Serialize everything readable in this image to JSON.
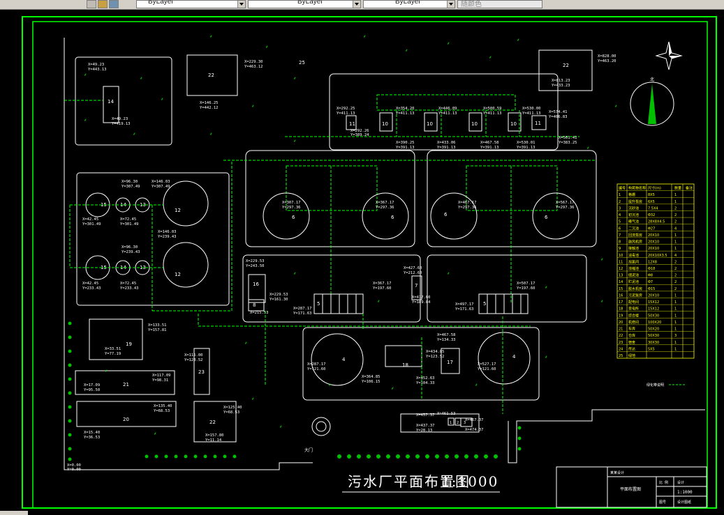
{
  "toolbar": {
    "layer_combo_1": "ByLayer",
    "layer_combo_2": "ByLayer",
    "layer_combo_3": "ByLayer",
    "color_combo": "随颜色"
  },
  "drawing": {
    "title": "污水厂平面布置图",
    "scale": "1:1000",
    "site_number": "25",
    "north_label": "北",
    "gate_label": "大门",
    "legend_label": "绿化带说明"
  },
  "units": [
    {
      "id": "u14",
      "num": "14",
      "coords": [
        "X=49.23",
        "Y=443.13"
      ]
    },
    {
      "id": "u14b",
      "num": "",
      "coords": [
        "X=49.23",
        "Y=419.13"
      ]
    },
    {
      "id": "u22a",
      "num": "22",
      "coords": [
        "X=229.30",
        "Y=463.12",
        "X=146.25",
        "Y=442.12"
      ]
    },
    {
      "id": "u22b",
      "num": "22",
      "coords": [
        "X=828.00",
        "Y=463.20",
        "X=813.23",
        "Y=433.23"
      ]
    },
    {
      "id": "u11a",
      "num": "11",
      "coords": [
        "X=292.25",
        "Y=411.13",
        "X=292.26",
        "Y=389.24"
      ]
    },
    {
      "id": "u10",
      "num": "10",
      "coords": [
        "X=354.20",
        "Y=411.13",
        "X=390.25",
        "Y=391.13"
      ]
    },
    {
      "id": "u10b",
      "num": "10",
      "coords": [
        "X=446.09",
        "Y=411.13",
        "X=433.06",
        "Y=391.13"
      ]
    },
    {
      "id": "u10c",
      "num": "10",
      "coords": [
        "X=500.59",
        "Y=411.13",
        "X=467.58",
        "Y=391.13"
      ]
    },
    {
      "id": "u10d",
      "num": "10",
      "coords": [
        "X=530.00",
        "Y=411.13",
        "X=530.01",
        "Y=391.13"
      ]
    },
    {
      "id": "u11b",
      "num": "11",
      "coords": [
        "X=574.41",
        "Y=406.83",
        "X=561.41",
        "Y=383.25"
      ]
    },
    {
      "id": "u15a",
      "num": "15",
      "coords": [
        "X=96.30",
        "Y=307.49",
        "X=42.45",
        "Y=301.49"
      ]
    },
    {
      "id": "u14c",
      "num": "14",
      "coords": [
        "X=72.45",
        "Y=301.49"
      ]
    },
    {
      "id": "u13a",
      "num": "13",
      "coords": []
    },
    {
      "id": "u12a",
      "num": "12",
      "coords": [
        "X=146.03",
        "Y=307.49"
      ]
    },
    {
      "id": "u12b",
      "num": "12",
      "coords": [
        "X=146.03",
        "Y=239.43"
      ]
    },
    {
      "id": "u15b",
      "num": "15",
      "coords": [
        "X=96.30",
        "Y=239.43",
        "X=42.45",
        "Y=233.43"
      ]
    },
    {
      "id": "u14d",
      "num": "14",
      "coords": [
        "X=72.45",
        "Y=233.43"
      ]
    },
    {
      "id": "u13b",
      "num": "13",
      "coords": []
    },
    {
      "id": "u6a",
      "num": "6",
      "coords": [
        "X=307.17",
        "Y=297.36"
      ]
    },
    {
      "id": "u6b",
      "num": "6",
      "coords": [
        "X=367.17",
        "Y=297.36"
      ]
    },
    {
      "id": "u6c",
      "num": "6",
      "coords": [
        "X=467.17",
        "Y=297.36"
      ]
    },
    {
      "id": "u6d",
      "num": "6",
      "coords": [
        "X=567.17",
        "Y=297.36"
      ]
    },
    {
      "id": "u16",
      "num": "16",
      "coords": [
        "X=229.53",
        "Y=243.50",
        "X=229.53",
        "Y=161.30"
      ]
    },
    {
      "id": "u8",
      "num": "8",
      "coords": [
        "X=215.53",
        "Y=179.50"
      ]
    },
    {
      "id": "u5a",
      "num": "5",
      "coords": [
        "X=367.17",
        "Y=197.60",
        "X=287.17",
        "Y=171.63"
      ]
    },
    {
      "id": "u7",
      "num": "7",
      "coords": [
        "X=427.60",
        "Y=212.60",
        "X=417.60",
        "Y=189.84"
      ]
    },
    {
      "id": "u5b",
      "num": "5",
      "coords": [
        "X=507.17",
        "Y=197.60",
        "X=497.17",
        "Y=171.63"
      ]
    },
    {
      "id": "u19",
      "num": "19",
      "coords": [
        "X=133.51",
        "Y=157.81",
        "X=33.51",
        "Y=77.19"
      ]
    },
    {
      "id": "u23",
      "num": "23",
      "coords": [
        "X=115.00",
        "Y=123.52"
      ]
    },
    {
      "id": "u21",
      "num": "21",
      "coords": [
        "X=117.09",
        "Y=98.31",
        "X=17.09",
        "Y=95.50"
      ]
    },
    {
      "id": "u20",
      "num": "20",
      "coords": [
        "X=135.40",
        "Y=68.53",
        "X=15.40",
        "Y=36.53"
      ]
    },
    {
      "id": "u22c",
      "num": "22",
      "coords": [
        "X=125.40",
        "Y=68.53",
        "X=157.80",
        "Y=11.14"
      ]
    },
    {
      "id": "u4a",
      "num": "4",
      "coords": [
        "X=287.17",
        "Y=121.60"
      ]
    },
    {
      "id": "u18",
      "num": "18",
      "coords": [
        "X=434.85",
        "Y=123.52",
        "X=364.85",
        "Y=106.15"
      ]
    },
    {
      "id": "u17",
      "num": "17",
      "coords": [
        "X=467.58",
        "Y=134.33",
        "X=452.63",
        "Y=104.33"
      ]
    },
    {
      "id": "u4b",
      "num": "4",
      "coords": [
        "X=527.17",
        "Y=121.60"
      ]
    },
    {
      "id": "u1",
      "num": "1",
      "coords": [
        "X=457.37",
        "Y=40.05",
        "X=437.37",
        "Y=28.13"
      ]
    },
    {
      "id": "u2",
      "num": "2",
      "coords": [
        "X=461.53",
        "Y=40.05"
      ]
    },
    {
      "id": "u3",
      "num": "3",
      "coords": [
        "X=467.37",
        "Y=40.05",
        "X=474.37",
        "Y=40.87"
      ]
    },
    {
      "id": "uorigin",
      "num": "",
      "coords": [
        "X=0.00",
        "Y=0.00"
      ]
    }
  ],
  "table": {
    "headers": [
      "编号",
      "构筑物名称",
      "尺寸(m)",
      "数量",
      "备注"
    ],
    "rows": [
      [
        "1",
        "格栅",
        "8X5",
        "1",
        ""
      ],
      [
        "2",
        "提升泵房",
        "6X5",
        "1",
        ""
      ],
      [
        "3",
        "沉砂池",
        "7.5X4",
        "2",
        ""
      ],
      [
        "4",
        "初沉池",
        "Φ32",
        "2",
        ""
      ],
      [
        "5",
        "曝气池",
        "28X8X4.5",
        "2",
        ""
      ],
      [
        "6",
        "二沉池",
        "Φ27",
        "4",
        ""
      ],
      [
        "7",
        "回流泵房",
        "20X10",
        "1",
        ""
      ],
      [
        "8",
        "鼓风机房",
        "20X10",
        "1",
        ""
      ],
      [
        "9",
        "接触池",
        "20X10",
        "1",
        ""
      ],
      [
        "10",
        "消毒池",
        "20X10X3.5",
        "4",
        ""
      ],
      [
        "11",
        "加氯间",
        "12X8",
        "2",
        ""
      ],
      [
        "12",
        "浓缩池",
        "Φ18",
        "2",
        ""
      ],
      [
        "13",
        "储泥池",
        "Φ8",
        "2",
        ""
      ],
      [
        "14",
        "贮泥池",
        "Φ7",
        "2",
        ""
      ],
      [
        "15",
        "脱水机房",
        "Φ15",
        "2",
        ""
      ],
      [
        "16",
        "污泥泵房",
        "20X10",
        "1",
        ""
      ],
      [
        "17",
        "配电间",
        "15X12",
        "1",
        ""
      ],
      [
        "18",
        "变电所",
        "15X12",
        "1",
        ""
      ],
      [
        "19",
        "综合楼",
        "50X30",
        "1",
        ""
      ],
      [
        "20",
        "机修间",
        "100X20",
        "1",
        ""
      ],
      [
        "21",
        "车库",
        "50X20",
        "1",
        ""
      ],
      [
        "22",
        "仓库",
        "50X30",
        "3",
        ""
      ],
      [
        "23",
        "宿舍",
        "30X30",
        "1",
        ""
      ],
      [
        "24",
        "传达",
        "5X5",
        "1",
        ""
      ],
      [
        "25",
        "绿地",
        "",
        "",
        ""
      ]
    ]
  },
  "title_block": {
    "company": "某某设计",
    "drawing_name": "平面布置图",
    "label_scale": "比 例",
    "scale_value": "1:1000",
    "label_drawn": "设计",
    "label_sheet": "图号",
    "sheet_value": "设计图纸"
  },
  "colors": {
    "frame": "#00ff00",
    "lines": "#ffffff",
    "pipes": "#00ff00",
    "table_text": "#ffff00",
    "background": "#000000"
  }
}
